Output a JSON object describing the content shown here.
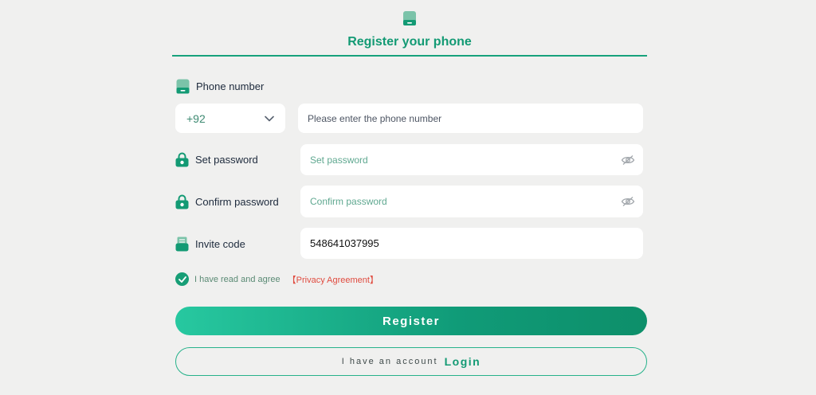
{
  "header": {
    "title": "Register your phone"
  },
  "phone": {
    "label": "Phone number",
    "country_code": "+92",
    "placeholder": "Please enter the phone number"
  },
  "password": {
    "label": "Set password",
    "placeholder": "Set password"
  },
  "confirm_password": {
    "label": "Confirm password",
    "placeholder": "Confirm password"
  },
  "invite": {
    "label": "Invite code",
    "value": "548641037995"
  },
  "agreement": {
    "checked": true,
    "text": "I have read and agree",
    "link": "【Privacy Agreement】"
  },
  "actions": {
    "register_label": "Register",
    "account_hint": "I have an account",
    "login_label": "Login"
  },
  "colors": {
    "accent": "#139a74",
    "link_red": "#e04b3f",
    "background": "#f0f0ef"
  },
  "icons": [
    "phone-icon",
    "lock-icon",
    "invite-icon",
    "chevron-down-icon",
    "eye-off-icon",
    "check-icon"
  ]
}
